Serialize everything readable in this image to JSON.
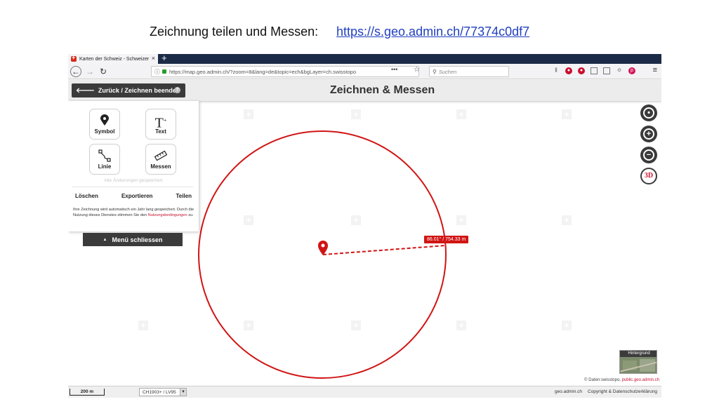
{
  "slide": {
    "caption": "Zeichnung teilen und Messen:",
    "link": "https://s.geo.admin.ch/77374c0df7"
  },
  "browser": {
    "tab_title": "Karten der Schweiz - Schweizer",
    "tab_close": "×",
    "new_tab": "+",
    "url": "https://map.geo.admin.ch/?zoom=8&lang=de&topic=ech&bgLayer=ch.swisstopo",
    "url_more": "•••",
    "search_placeholder": "Suchen"
  },
  "app": {
    "header_title": "Zeichnen & Messen",
    "back_button": "Zurück / Zeichnen beenden",
    "help": "?",
    "tools": [
      {
        "label": "Symbol",
        "icon": "map-pin-icon"
      },
      {
        "label": "Text",
        "icon": "text-icon"
      },
      {
        "label": "Linie",
        "icon": "line-icon"
      },
      {
        "label": "Messen",
        "icon": "ruler-icon"
      }
    ],
    "saved_message": "Alle Änderungen gespeichert",
    "actions": {
      "delete": "Löschen",
      "export": "Exportieren",
      "share": "Teilen"
    },
    "notice_text": "Ihre Zeichnung wird automatisch ein Jahr lang gespeichert. Durch die Nutzung dieses Dienstes stimmen Sie den",
    "notice_link": "Nutzungsbedingungen",
    "notice_suffix": "zu.",
    "close_menu": "Menü schliessen",
    "measure_label": "86.01° / 754.33 m",
    "controls": {
      "zoom_in": "+",
      "zoom_out": "−",
      "three_d": "3D"
    },
    "background_label": "Hintergrund",
    "attribution_prefix": "© Daten:swisstopo,",
    "attribution_link": "public.geo.admin.ch",
    "scale": "200 m",
    "crs": "CH1903+ / LV95",
    "footer_site": "geo.admin.ch",
    "footer_copyright": "Copyright & Datenschutzerklärung"
  },
  "colors": {
    "drawing_red": "#d11414",
    "dark_button": "#3b3b3b",
    "tabbar": "#1b2b47"
  }
}
